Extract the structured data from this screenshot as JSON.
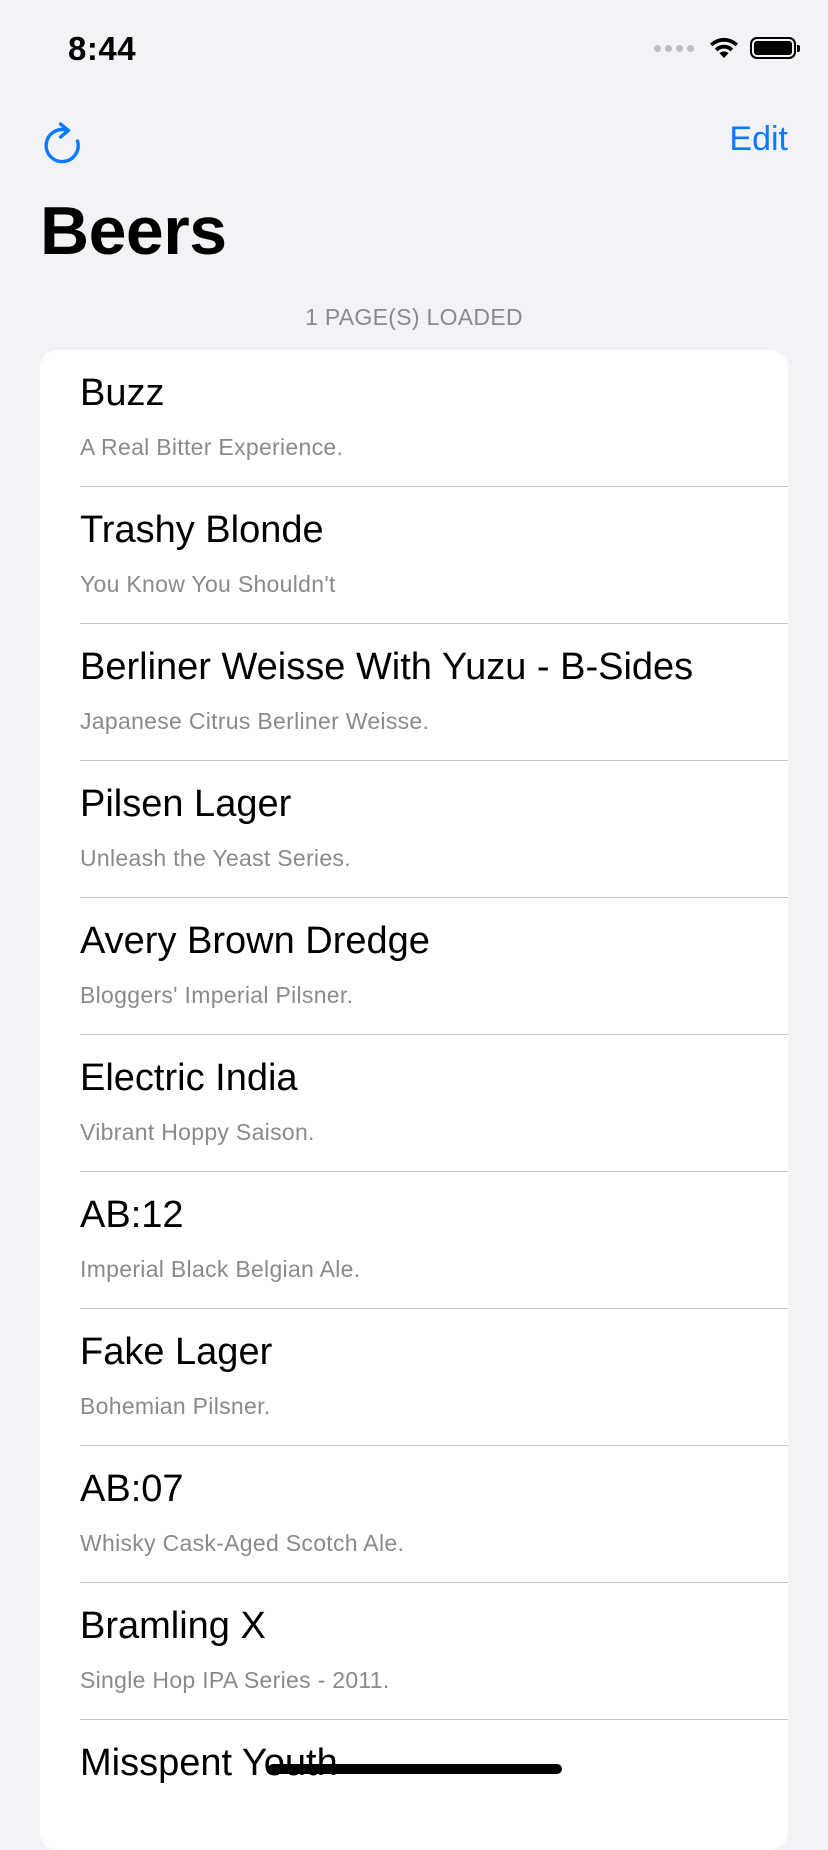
{
  "status_bar": {
    "time": "8:44"
  },
  "nav": {
    "refresh_icon": "arrow-clockwise-icon",
    "edit_label": "Edit"
  },
  "page_title": "Beers",
  "section_header": "1 PAGE(S) LOADED",
  "accent_color": "#0A7AFF",
  "beers": [
    {
      "name": "Buzz",
      "tagline": "A Real Bitter Experience."
    },
    {
      "name": "Trashy Blonde",
      "tagline": "You Know You Shouldn't"
    },
    {
      "name": "Berliner Weisse With Yuzu - B-Sides",
      "tagline": "Japanese Citrus Berliner Weisse."
    },
    {
      "name": "Pilsen Lager",
      "tagline": "Unleash the Yeast Series."
    },
    {
      "name": "Avery Brown Dredge",
      "tagline": "Bloggers' Imperial Pilsner."
    },
    {
      "name": "Electric India",
      "tagline": "Vibrant Hoppy Saison."
    },
    {
      "name": "AB:12",
      "tagline": "Imperial Black Belgian Ale."
    },
    {
      "name": "Fake Lager",
      "tagline": "Bohemian Pilsner."
    },
    {
      "name": "AB:07",
      "tagline": "Whisky Cask-Aged Scotch Ale."
    },
    {
      "name": "Bramling X",
      "tagline": "Single Hop IPA Series - 2011."
    },
    {
      "name": "Misspent Youth",
      "tagline": ""
    }
  ]
}
